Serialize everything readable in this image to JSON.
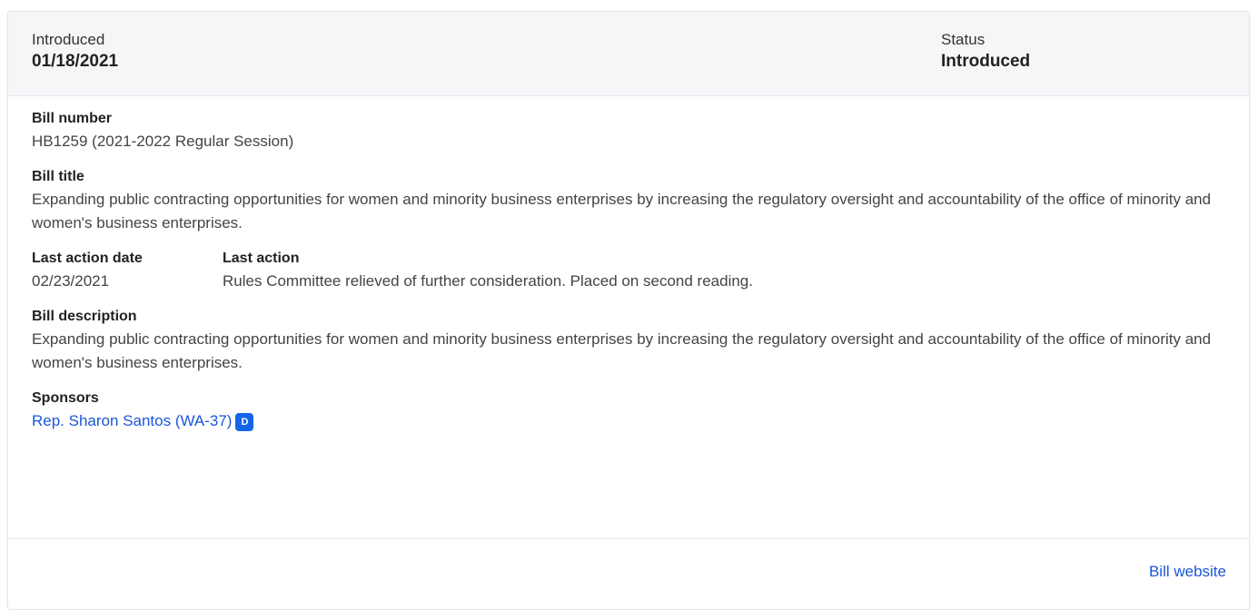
{
  "header": {
    "introduced_label": "Introduced",
    "introduced_value": "01/18/2021",
    "status_label": "Status",
    "status_value": "Introduced"
  },
  "bill_number": {
    "label": "Bill number",
    "value": "HB1259 (2021-2022 Regular Session)"
  },
  "bill_title": {
    "label": "Bill title",
    "value": "Expanding public contracting opportunities for women and minority business enterprises by increasing the regulatory oversight and accountability of the office of minority and women's business enterprises."
  },
  "last_action_date": {
    "label": "Last action date",
    "value": "02/23/2021"
  },
  "last_action": {
    "label": "Last action",
    "value": "Rules Committee relieved of further consideration. Placed on second reading."
  },
  "bill_description": {
    "label": "Bill description",
    "value": "Expanding public contracting opportunities for women and minority business enterprises by increasing the regulatory oversight and accountability of the office of minority and women's business enterprises."
  },
  "sponsors": {
    "label": "Sponsors",
    "items": [
      {
        "name": "Rep. Sharon Santos (WA-37)",
        "party": "D"
      }
    ]
  },
  "footer": {
    "bill_website_label": "Bill website"
  },
  "colors": {
    "link": "#1a56db",
    "party_badge": "#1565e8",
    "header_bg": "#f5f6f8"
  }
}
